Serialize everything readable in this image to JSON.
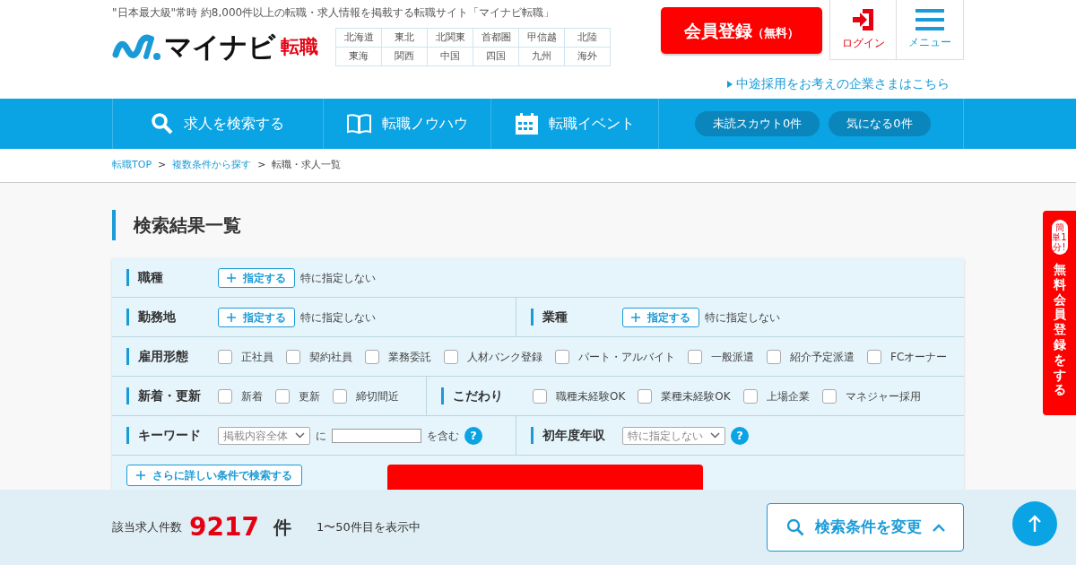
{
  "header": {
    "tagline": "\"日本最大級\"常時 約8,000件以上の転職・求人情報を掲載する転職サイト「マイナビ転職」",
    "logo_word": "マイナビ",
    "logo_sub": "転職",
    "regions": [
      "北海道",
      "東北",
      "北関東",
      "首都圏",
      "甲信越",
      "北陸",
      "東海",
      "関西",
      "中国",
      "四国",
      "九州",
      "海外"
    ],
    "register_button": {
      "label": "会員登録",
      "sub": "（無料）"
    },
    "login": "ログイン",
    "menu": "メニュー",
    "corporate_link": "中途採用をお考えの企業さまはこちら"
  },
  "nav": {
    "items": [
      {
        "label": "求人を検索する"
      },
      {
        "label": "転職ノウハウ"
      },
      {
        "label": "転職イベント"
      }
    ],
    "pills": [
      "未読スカウト0件",
      "気になる0件"
    ]
  },
  "breadcrumb": {
    "items": [
      {
        "label": "転職TOP",
        "link": true
      },
      {
        "label": "複数条件から探す",
        "link": true
      },
      {
        "label": "転職・求人一覧",
        "link": false
      }
    ],
    "separators": [
      ">",
      ">"
    ]
  },
  "page_title": "検索結果一覧",
  "search_form": {
    "rows": [
      {
        "cells": [
          {
            "label": "職種",
            "kind": "specify",
            "button": "指定する",
            "value": "特に指定しない"
          }
        ]
      },
      {
        "cells": [
          {
            "label": "勤務地",
            "kind": "specify",
            "button": "指定する",
            "value": "特に指定しない"
          },
          {
            "label": "業種",
            "kind": "specify",
            "button": "指定する",
            "value": "特に指定しない"
          }
        ]
      },
      {
        "cells": [
          {
            "label": "雇用形態",
            "kind": "checks",
            "options": [
              {
                "label": "正社員",
                "checked": false
              },
              {
                "label": "契約社員",
                "checked": false
              },
              {
                "label": "業務委託",
                "checked": false
              },
              {
                "label": "人材バンク登録",
                "checked": false
              },
              {
                "label": "パート・アルバイト",
                "checked": false
              },
              {
                "label": "一般派遣",
                "checked": false
              },
              {
                "label": "紹介予定派遣",
                "checked": false
              },
              {
                "label": "FCオーナー",
                "checked": false
              }
            ]
          }
        ]
      },
      {
        "cells": [
          {
            "label": "新着・更新",
            "kind": "checks",
            "options": [
              {
                "label": "新着",
                "checked": false
              },
              {
                "label": "更新",
                "checked": false
              },
              {
                "label": "締切間近",
                "checked": false
              }
            ]
          },
          {
            "label": "こだわり",
            "kind": "checks",
            "options": [
              {
                "label": "職種未経験OK",
                "checked": false
              },
              {
                "label": "業種未経験OK",
                "checked": false
              },
              {
                "label": "上場企業",
                "checked": false
              },
              {
                "label": "マネジャー採用",
                "checked": false
              }
            ]
          }
        ]
      },
      {
        "cells": [
          {
            "label": "キーワード",
            "kind": "keyword",
            "select": "掲載内容全体",
            "connector": "に",
            "suffix": "を含む",
            "help": "?"
          },
          {
            "label": "初年度年収",
            "kind": "select",
            "select": "特に指定しない",
            "help": "?"
          }
        ]
      }
    ],
    "more_conditions": "さらに詳しい条件で検索する"
  },
  "result_bar": {
    "label": "該当求人件数",
    "count": "9217",
    "unit": "件",
    "range": "1〜50件目を表示中",
    "change_button": "検索条件を変更"
  },
  "side_tab": {
    "badge": "簡単1分!",
    "label": "無料会員登録をする"
  }
}
